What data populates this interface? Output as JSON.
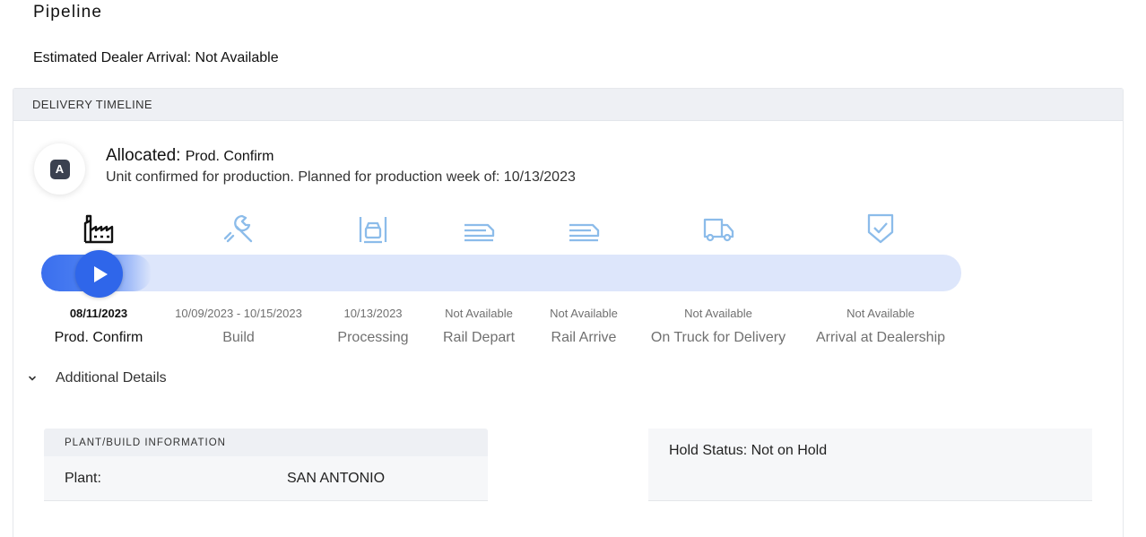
{
  "page": {
    "title": "Pipeline",
    "estimated_arrival": "Estimated Dealer Arrival: Not Available"
  },
  "timeline": {
    "header": "DELIVERY TIMELINE",
    "status": {
      "badge_letter": "A",
      "label": "Allocated:",
      "sublabel": "Prod. Confirm",
      "description": "Unit confirmed for production. Planned for production week of: 10/13/2023"
    },
    "progress_fraction": 0.12,
    "steps": [
      {
        "label": "Prod. Confirm",
        "date": "08/11/2023",
        "icon": "factory-icon",
        "active": true
      },
      {
        "label": "Build",
        "date": "10/09/2023 - 10/15/2023",
        "icon": "wrench-icon",
        "active": false
      },
      {
        "label": "Processing",
        "date": "10/13/2023",
        "icon": "vehicle-bay-icon",
        "active": false
      },
      {
        "label": "Rail Depart",
        "date": "Not Available",
        "icon": "rail-car-icon",
        "active": false
      },
      {
        "label": "Rail Arrive",
        "date": "Not Available",
        "icon": "rail-car-icon",
        "active": false
      },
      {
        "label": "On Truck for Delivery",
        "date": "Not Available",
        "icon": "truck-icon",
        "active": false
      },
      {
        "label": "Arrival at Dealership",
        "date": "Not Available",
        "icon": "shield-check-icon",
        "active": false
      }
    ]
  },
  "details": {
    "toggle_label": "Additional Details",
    "plant_section": {
      "header": "PLANT/BUILD INFORMATION",
      "key": "Plant:",
      "value": "SAN ANTONIO"
    },
    "hold_status": "Hold Status: Not on Hold"
  },
  "colors": {
    "accent": "#2f66ea",
    "track": "#dde6fb",
    "inactive_icon": "#8cbcea",
    "active_icon": "#111111"
  }
}
